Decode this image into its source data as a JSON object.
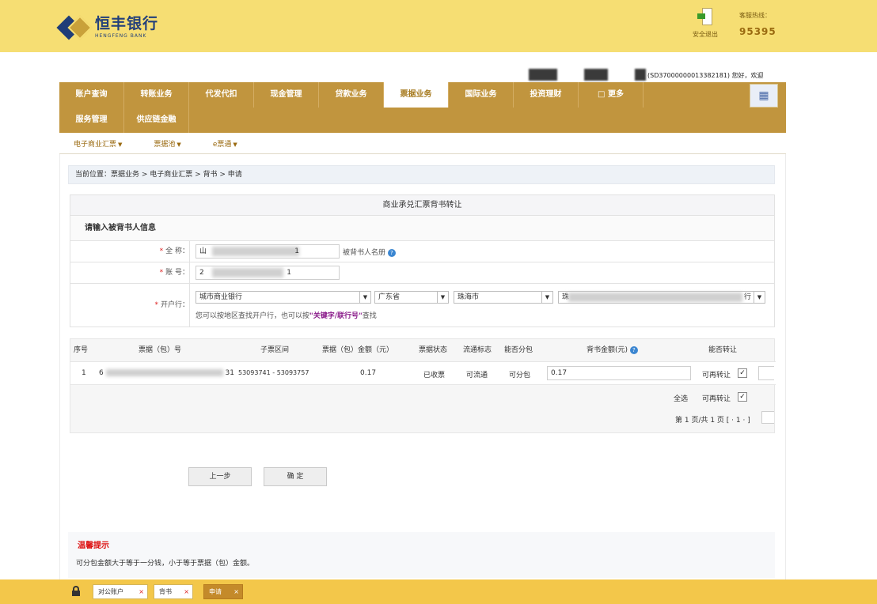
{
  "header": {
    "bank_name_cn": "恒丰银行",
    "bank_name_en": "HENGFENG BANK",
    "exit_label": "安全退出",
    "hotline_label": "客服热线：",
    "hotline_number": "95395"
  },
  "user": {
    "info": "(SD37000000013382181) 您好，欢迎"
  },
  "nav": {
    "row1": [
      "账户查询",
      "转账业务",
      "代发代扣",
      "现金管理",
      "贷款业务",
      "票据业务",
      "国际业务",
      "投资理财",
      "□ 更多"
    ],
    "row2": [
      "服务管理",
      "供应链金融"
    ],
    "active": "票据业务",
    "grid_icon": "grid-icon"
  },
  "subnav": [
    "电子商业汇票",
    "票据池",
    "e票通"
  ],
  "breadcrumb": "当前位置：票据业务 > 电子商业汇票 > 背书 > 申请",
  "form": {
    "title": "商业承兑汇票背书转让",
    "subtitle": "请输入被背书人信息",
    "account_name_label": "全 称：",
    "account_name_value": "山",
    "account_name_tail": "1",
    "account_name_hint": "被背书人名册",
    "account_no_label": "账 号：",
    "account_no_value": "2",
    "account_no_tail": "1",
    "bank_label": "开户行：",
    "bank_type": "城市商业银行",
    "province": "广东省",
    "city": "珠海市",
    "bank_branch_prefix": "珠",
    "bank_branch_suffix": "行",
    "bank_hint_prefix": "您可以按地区查找开户行，也可以按",
    "bank_hint_keyword": "\"关键字/联行号\"",
    "bank_hint_suffix": "查找"
  },
  "table": {
    "headers": [
      "序号",
      "票据（包）号",
      "子票区间",
      "票据（包）金额（元）",
      "票据状态",
      "流通标志",
      "能否分包",
      "背书金额(元)",
      "能否转让"
    ],
    "rows": [
      {
        "index": "1",
        "bill_no_prefix": "6",
        "bill_no_suffix": "31",
        "range": "53093741 - 53093757",
        "amount": "0.17",
        "status": "已收票",
        "flow": "可流通",
        "split": "可分包",
        "endorse_amount": "0.17",
        "transfer": "可再转让"
      }
    ],
    "select_all_label": "全选",
    "select_all_value": "可再转让",
    "pagination": "第 1 页/共 1 页 [ · 1 · ]"
  },
  "buttons": {
    "prev": "上一步",
    "confirm": "确 定"
  },
  "notice": {
    "title": "温馨提示",
    "text": "可分包金额大于等于一分钱，小于等于票据（包）金额。"
  },
  "bottom_tabs": [
    {
      "label": "对公账户",
      "active": false
    },
    {
      "label": "背书",
      "active": false
    },
    {
      "label": "申请",
      "active": true
    }
  ],
  "colors": {
    "header_bg": "#f6de73",
    "nav_bg": "#c1953e",
    "accent": "#a77c22",
    "required": "#d22222"
  }
}
